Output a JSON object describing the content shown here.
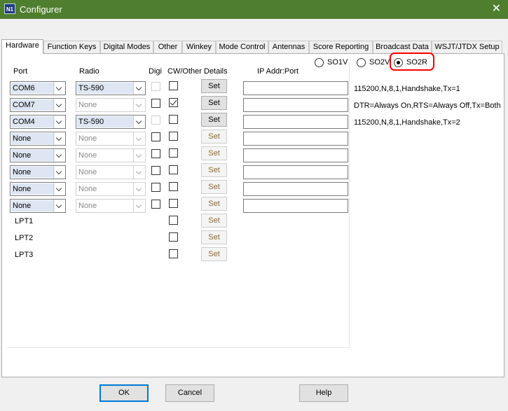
{
  "window": {
    "title": "Configurer",
    "icon_label": "N1",
    "close_label": "✕"
  },
  "tabs": [
    "Hardware",
    "Function Keys",
    "Digital Modes",
    "Other",
    "Winkey",
    "Mode Control",
    "Antennas",
    "Score Reporting",
    "Broadcast Data",
    "WSJT/JTDX Setup"
  ],
  "active_tab": "Hardware",
  "columns": {
    "port": "Port",
    "radio": "Radio",
    "digi": "Digi",
    "cw_other": "CW/Other",
    "details": "Details",
    "ip": "IP Addr:Port"
  },
  "so_modes": [
    {
      "label": "SO1V",
      "selected": false
    },
    {
      "label": "SO2V",
      "selected": false
    },
    {
      "label": "SO2R",
      "selected": true
    }
  ],
  "rows": [
    {
      "port": "COM6",
      "radio": "TS-590",
      "radio_enabled": true,
      "digi_enabled": false,
      "digi": false,
      "cw": false,
      "set": "Set",
      "set_enabled": true,
      "ip": "",
      "detail": "115200,N,8,1,Handshake,Tx=1"
    },
    {
      "port": "COM7",
      "radio": "None",
      "radio_enabled": false,
      "digi_enabled": true,
      "digi": false,
      "cw": true,
      "set": "Set",
      "set_enabled": true,
      "ip": "",
      "detail": "DTR=Always On,RTS=Always Off,Tx=Both"
    },
    {
      "port": "COM4",
      "radio": "TS-590",
      "radio_enabled": true,
      "digi_enabled": false,
      "digi": false,
      "cw": false,
      "set": "Set",
      "set_enabled": true,
      "ip": "",
      "detail": "115200,N,8,1,Handshake,Tx=2"
    },
    {
      "port": "None",
      "radio": "None",
      "radio_enabled": false,
      "digi_enabled": true,
      "digi": false,
      "cw": false,
      "set": "Set",
      "set_enabled": false,
      "ip": "",
      "detail": ""
    },
    {
      "port": "None",
      "radio": "None",
      "radio_enabled": false,
      "digi_enabled": true,
      "digi": false,
      "cw": false,
      "set": "Set",
      "set_enabled": false,
      "ip": "",
      "detail": ""
    },
    {
      "port": "None",
      "radio": "None",
      "radio_enabled": false,
      "digi_enabled": true,
      "digi": false,
      "cw": false,
      "set": "Set",
      "set_enabled": false,
      "ip": "",
      "detail": ""
    },
    {
      "port": "None",
      "radio": "None",
      "radio_enabled": false,
      "digi_enabled": true,
      "digi": false,
      "cw": false,
      "set": "Set",
      "set_enabled": false,
      "ip": "",
      "detail": ""
    },
    {
      "port": "None",
      "radio": "None",
      "radio_enabled": false,
      "digi_enabled": true,
      "digi": false,
      "cw": false,
      "set": "Set",
      "set_enabled": false,
      "ip": "",
      "detail": ""
    }
  ],
  "lpt_rows": [
    {
      "label": "LPT1",
      "cw": false,
      "set": "Set"
    },
    {
      "label": "LPT2",
      "cw": false,
      "set": "Set"
    },
    {
      "label": "LPT3",
      "cw": false,
      "set": "Set"
    }
  ],
  "buttons": {
    "ok": "OK",
    "cancel": "Cancel",
    "help": "Help"
  },
  "colors": {
    "titlebar": "#4f7e2f",
    "highlight": "#ff0000",
    "default_button_border": "#0078d7"
  }
}
